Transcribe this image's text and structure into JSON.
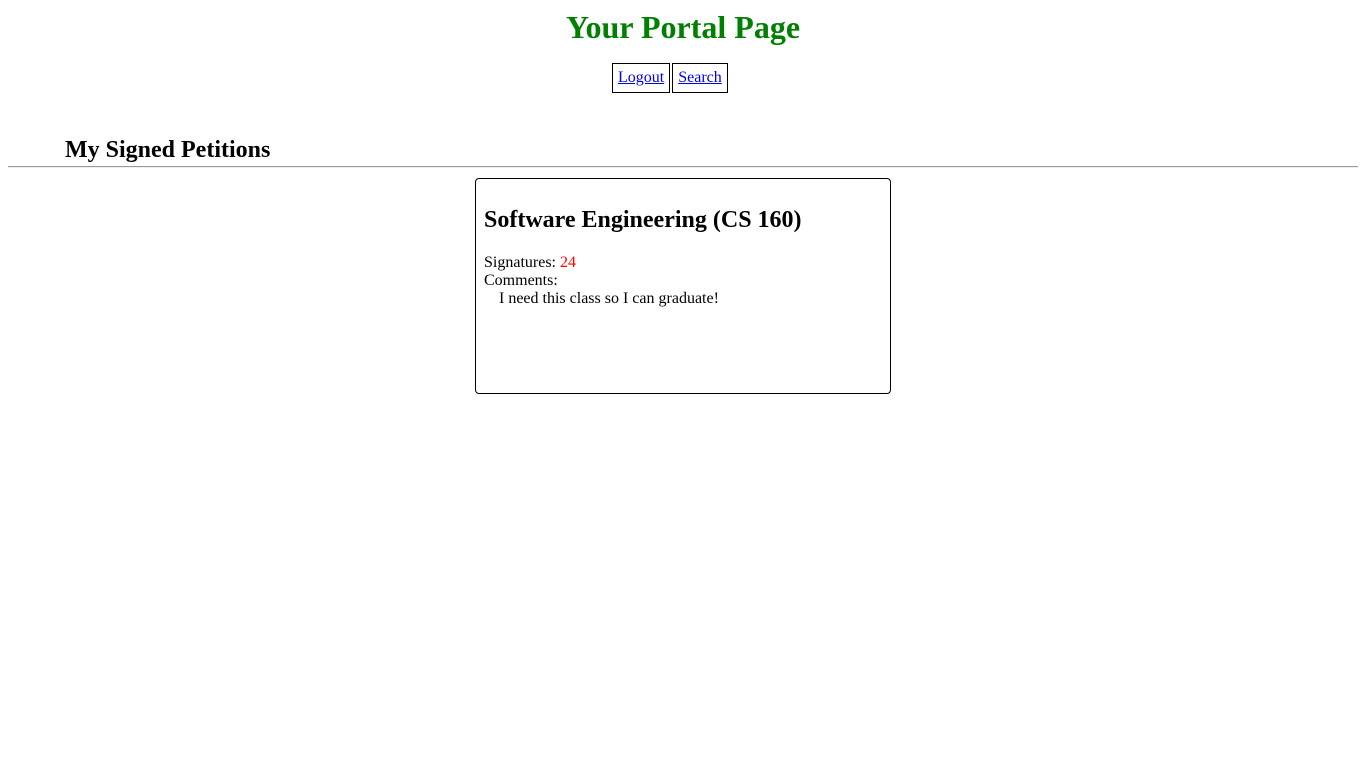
{
  "header": {
    "title": "Your Portal Page"
  },
  "nav": {
    "logout_label": "Logout",
    "search_label": "Search"
  },
  "section": {
    "heading": "My Signed Petitions"
  },
  "petitions": [
    {
      "title": "Software Engineering (CS 160)",
      "signatures_label": "Signatures:",
      "signatures_count": "24",
      "comments_label": "Comments:",
      "comments": [
        "I need this class so I can graduate!"
      ]
    }
  ],
  "colors": {
    "title": "#008000",
    "link": "#0000ee",
    "signature_count": "#ff0000"
  }
}
